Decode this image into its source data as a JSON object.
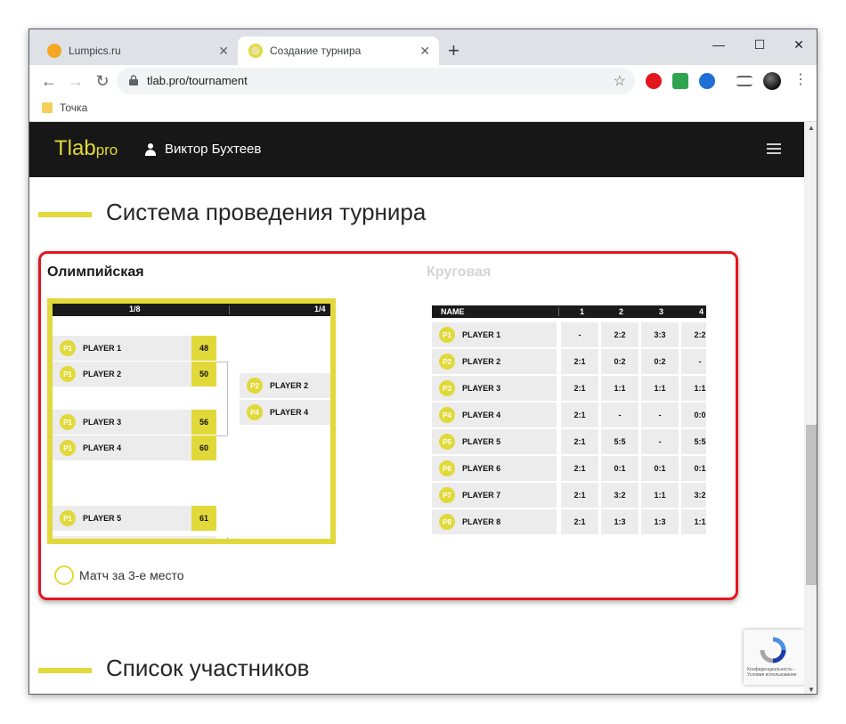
{
  "browser": {
    "tabs": [
      {
        "title": "Lumpics.ru",
        "favicon_color": "#f5a623"
      },
      {
        "title": "Создание турнира",
        "favicon_color": "#e1d93a"
      }
    ],
    "url": "tlab.pro/tournament",
    "bookmark": "Точка"
  },
  "site": {
    "logo": "Tlab",
    "logo_suffix": "pro",
    "user_name": "Виктор Бухтеев",
    "accent_color": "#e1d93a"
  },
  "section_system": {
    "title": "Система проведения турнира",
    "option_olympic": "Олимпийская",
    "option_round": "Круговая",
    "bracket": {
      "round_labels": [
        "1/8",
        "1/4"
      ],
      "first_round": [
        {
          "chip": "P1",
          "name": "PLAYER 1",
          "score": "48"
        },
        {
          "chip": "P1",
          "name": "PLAYER 2",
          "score": "50"
        },
        {
          "chip": "P1",
          "name": "PLAYER 3",
          "score": "56"
        },
        {
          "chip": "P1",
          "name": "PLAYER 4",
          "score": "60"
        },
        {
          "chip": "P1",
          "name": "PLAYER 5",
          "score": "61"
        }
      ],
      "second_round": [
        {
          "chip": "P2",
          "name": "PLAYER 2"
        },
        {
          "chip": "P4",
          "name": "PLAYER 4"
        }
      ]
    },
    "third_place_label": "Матч за 3-е место",
    "round_robin": {
      "name_header": "NAME",
      "columns": [
        "1",
        "2",
        "3",
        "4"
      ],
      "rows": [
        {
          "chip": "P1",
          "name": "PLAYER 1",
          "cells": [
            "-",
            "2:2",
            "3:3",
            "2:2"
          ]
        },
        {
          "chip": "P2",
          "name": "PLAYER 2",
          "cells": [
            "2:1",
            "0:2",
            "0:2",
            "-"
          ]
        },
        {
          "chip": "P3",
          "name": "PLAYER 3",
          "cells": [
            "2:1",
            "1:1",
            "1:1",
            "1:1"
          ]
        },
        {
          "chip": "P4",
          "name": "PLAYER 4",
          "cells": [
            "2:1",
            "-",
            "-",
            "0:0"
          ]
        },
        {
          "chip": "P5",
          "name": "PLAYER 5",
          "cells": [
            "2:1",
            "5:5",
            "-",
            "5:5"
          ]
        },
        {
          "chip": "P6",
          "name": "PLAYER 6",
          "cells": [
            "2:1",
            "0:1",
            "0:1",
            "0:1"
          ]
        },
        {
          "chip": "P7",
          "name": "PLAYER 7",
          "cells": [
            "2:1",
            "3:2",
            "1:1",
            "3:2"
          ]
        },
        {
          "chip": "P8",
          "name": "PLAYER 8",
          "cells": [
            "2:1",
            "1:3",
            "1:3",
            "1:1"
          ]
        }
      ]
    }
  },
  "section_participants": {
    "title": "Список участников"
  },
  "recaptcha": {
    "text": "Конфиденциальность - Условия использования"
  }
}
